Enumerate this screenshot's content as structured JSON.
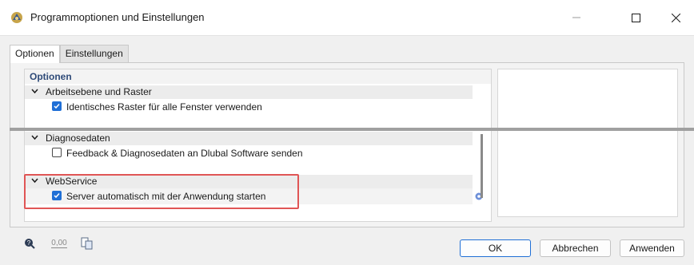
{
  "window": {
    "title": "Programmoptionen und Einstellungen",
    "icon": "dlubal-app-icon"
  },
  "tabs": [
    {
      "label": "Optionen",
      "active": true
    },
    {
      "label": "Einstellungen",
      "active": false
    }
  ],
  "main": {
    "section_title": "Optionen",
    "groups": [
      {
        "label": "Arbeitsebene und Raster",
        "options": [
          {
            "label": "Identisches Raster für alle Fenster verwenden",
            "checked": true
          }
        ]
      },
      {
        "label": "Diagnosedaten",
        "options": [
          {
            "label": "Feedback & Diagnosedaten an Dlubal Software senden",
            "checked": false
          }
        ]
      },
      {
        "label": "WebService",
        "options": [
          {
            "label": "Server automatisch mit der Anwendung starten",
            "checked": true,
            "has_settings_icon": true
          }
        ]
      }
    ]
  },
  "footer": {
    "icons": [
      "help-icon",
      "decimal-places-icon",
      "copy-settings-icon"
    ],
    "decimal_text": "0,00",
    "ok_label": "OK",
    "cancel_label": "Abbrechen",
    "apply_label": "Anwenden"
  },
  "colors": {
    "accent": "#1f6fd6",
    "highlight": "#e05555",
    "section_title": "#2e4a78"
  }
}
